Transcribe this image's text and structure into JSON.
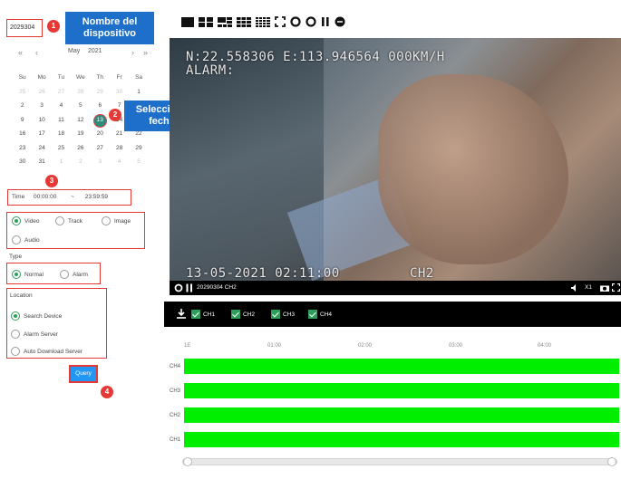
{
  "device": {
    "value": "2029304"
  },
  "callouts": {
    "device_name": "Nombre del dispositivo",
    "select_date": "Seleccione fecha"
  },
  "badges": [
    "1",
    "2",
    "3",
    "4"
  ],
  "calendar": {
    "prev_year": "«",
    "prev_month": "‹",
    "month": "May",
    "year": "2021",
    "next_month": "›",
    "next_year": "»",
    "weekdays": [
      "Su",
      "Mo",
      "Tu",
      "We",
      "Th",
      "Fr",
      "Sa"
    ],
    "weeks": [
      [
        "25",
        "26",
        "27",
        "28",
        "29",
        "30",
        "1"
      ],
      [
        "2",
        "3",
        "4",
        "5",
        "6",
        "7",
        "8"
      ],
      [
        "9",
        "10",
        "11",
        "12",
        "13",
        "14",
        "15"
      ],
      [
        "16",
        "17",
        "18",
        "19",
        "20",
        "21",
        "22"
      ],
      [
        "23",
        "24",
        "25",
        "26",
        "27",
        "28",
        "29"
      ],
      [
        "30",
        "31",
        "1",
        "2",
        "3",
        "4",
        "5"
      ]
    ],
    "selected": "13"
  },
  "time": {
    "label": "Time",
    "start": "00:00:00",
    "sep": "~",
    "end": "23:59:59"
  },
  "media_types": {
    "options": [
      "Video",
      "Track",
      "Image",
      "Audio"
    ],
    "selected": "Video"
  },
  "record_type": {
    "label": "Type",
    "options": [
      "Normal",
      "Alarm"
    ],
    "selected": "Normal"
  },
  "location": {
    "label": "Location",
    "options": [
      "Search Device",
      "Alarm Server",
      "Auto Download Server"
    ],
    "selected": "Search Device"
  },
  "query_label": "Query",
  "video": {
    "gps_line": "N:22.558306 E:113.946564 000KM/H",
    "alarm_line": "ALARM:",
    "timestamp": "13-05-2021 02:11:00",
    "channel": "CH2"
  },
  "player": {
    "title": "20290304 CH2",
    "speed": "X1"
  },
  "channels": [
    "CH1",
    "CH2",
    "CH3",
    "CH4"
  ],
  "timeline": {
    "ticks": [
      "1E",
      "01:00",
      "02:00",
      "03:00",
      "04:00"
    ],
    "tracks": [
      "CH4",
      "CH3",
      "CH2",
      "CH1"
    ]
  },
  "colors": {
    "accent": "#1d6fc9",
    "highlight": "#e53935",
    "selected_day": "#2f8a7e",
    "track": "#00ee00",
    "check": "#2e9e5b"
  }
}
